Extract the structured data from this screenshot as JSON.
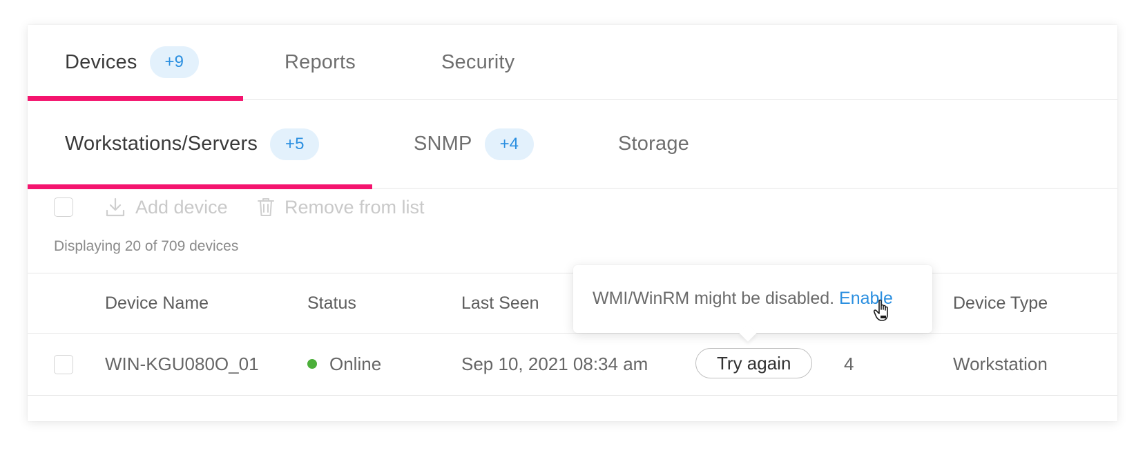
{
  "tabs": [
    {
      "label": "Devices",
      "badge": "+9",
      "active": true
    },
    {
      "label": "Reports",
      "active": false
    },
    {
      "label": "Security",
      "active": false
    }
  ],
  "subtabs": [
    {
      "label": "Workstations/Servers",
      "badge": "+5",
      "active": true
    },
    {
      "label": "SNMP",
      "badge": "+4",
      "active": false
    },
    {
      "label": "Storage",
      "active": false
    }
  ],
  "toolbar": {
    "add_device": "Add device",
    "remove_from_list": "Remove from list",
    "add_icon": "download-icon",
    "remove_icon": "trash-icon"
  },
  "displaying": "Displaying 20 of 709 devices",
  "table": {
    "headers": [
      "Device Name",
      "Status",
      "Last Seen",
      "Device Type"
    ],
    "rows": [
      {
        "device_name": "WIN-KGU080O_01",
        "status": "Online",
        "last_seen": "Sep 10, 2021 08:34 am",
        "action": "Try again",
        "count": "4",
        "device_type": "Workstation"
      }
    ]
  },
  "tooltip": {
    "text": "WMI/WinRM might be disabled. ",
    "link": "Enable"
  },
  "colors": {
    "accent": "#f4146e",
    "badge_bg": "#e3f1fc",
    "link": "#2b8fe0",
    "online": "#4caf3a"
  }
}
